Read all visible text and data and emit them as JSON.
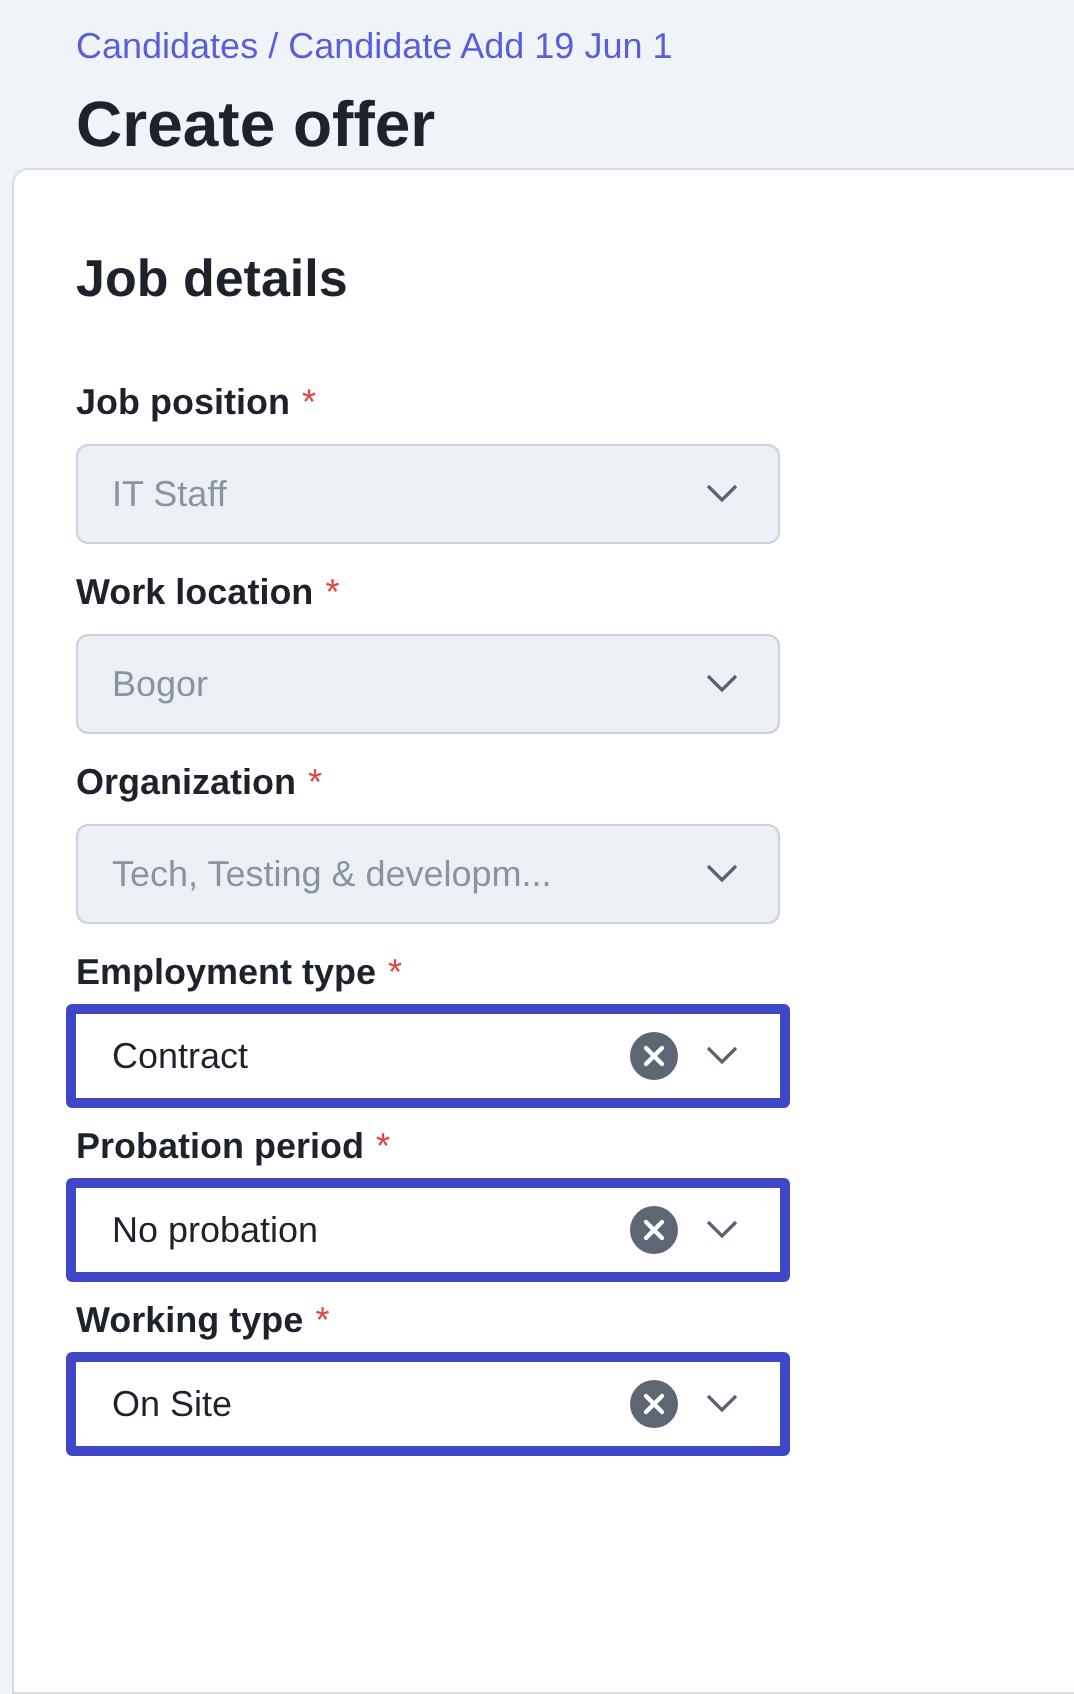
{
  "breadcrumb": "Candidates / Candidate Add 19 Jun 1",
  "title": "Create offer",
  "section": {
    "title": "Job details"
  },
  "fields": [
    {
      "label": "Job position",
      "required_mark": "*",
      "value": "IT Staff",
      "disabled": true,
      "highlighted": false
    },
    {
      "label": "Work location",
      "required_mark": "*",
      "value": "Bogor",
      "disabled": true,
      "highlighted": false
    },
    {
      "label": "Organization",
      "required_mark": "*",
      "value": "Tech, Testing & developm...",
      "disabled": true,
      "highlighted": false
    },
    {
      "label": "Employment type",
      "required_mark": "*",
      "value": "Contract",
      "disabled": false,
      "highlighted": true
    },
    {
      "label": "Probation period",
      "required_mark": "*",
      "value": "No probation",
      "disabled": false,
      "highlighted": true
    },
    {
      "label": "Working type",
      "required_mark": "*",
      "value": "On Site",
      "disabled": false,
      "highlighted": true
    }
  ]
}
